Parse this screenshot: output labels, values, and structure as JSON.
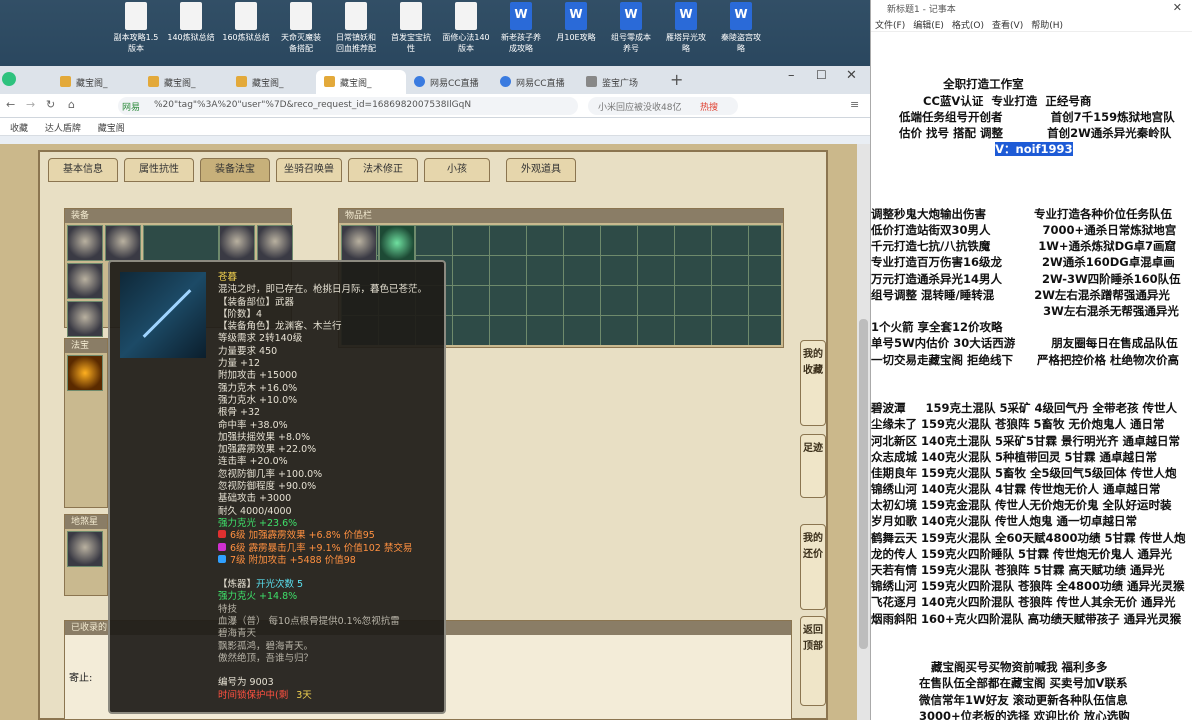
{
  "desktop_icons": [
    {
      "label": "副本攻略1.5\n版本",
      "word": false
    },
    {
      "label": "140炼狱总结",
      "word": false
    },
    {
      "label": "160炼狱总结",
      "word": false
    },
    {
      "label": "天命灭魔装\n备搭配",
      "word": false
    },
    {
      "label": "日常镇妖和\n回血推荐配",
      "word": false
    },
    {
      "label": "首发宝宝抗\n性",
      "word": false
    },
    {
      "label": "面修心法140\n版本",
      "word": false
    },
    {
      "label": "新老孩子养\n成攻略",
      "word": true
    },
    {
      "label": "月10E攻略",
      "word": true
    },
    {
      "label": "组号零成本\n养号",
      "word": true
    },
    {
      "label": "雁塔异光攻\n略",
      "word": true
    },
    {
      "label": "秦陵盗宫攻\n略",
      "word": true
    }
  ],
  "browser": {
    "tabs": [
      "藏宝阁_",
      "藏宝阁_",
      "藏宝阁_",
      "藏宝阁_",
      "网易CC直播",
      "网易CC直播",
      "鉴宝广场"
    ],
    "url": "%20\"tag\"%3A%20\"user\"%7D&reco_request_id=1686982007538IlGqN",
    "site_label": "网易",
    "search_text": "小米回应被没收48亿",
    "hot_label": "热搜",
    "bookmarks": [
      "收藏",
      "达人盾牌",
      "藏宝阁"
    ]
  },
  "game": {
    "tabs": [
      "基本信息",
      "属性抗性",
      "装备法宝",
      "坐骑召唤兽",
      "法术修正",
      "小孩",
      "外观道具"
    ],
    "equip_panel": "装备",
    "inventory_panel": "物品栏",
    "fabao_panel": "法宝",
    "pet_panel": "地煞星",
    "collect_panel": "已收录的",
    "collect_label": "寄止:",
    "side_buttons": [
      "我的收藏",
      "足迹",
      "我的还价",
      "返回顶部"
    ]
  },
  "tooltip": {
    "name": "苍暮",
    "desc": "混沌之时，即已存在。枪挑日月际，暮色已苍茫。",
    "lines": [
      "【装备部位】武器",
      "【阶数】4",
      "【装备角色】龙渊客、木兰行",
      "等级需求 2转140级",
      "力量要求 450",
      "力量 +12",
      "附加攻击 +15000",
      "强力克木 +16.0%",
      "强力克水 +10.0%",
      "根骨 +32",
      "命中率 +38.0%",
      "加强扶摇效果 +8.0%",
      "加强霹雳效果 +22.0%",
      "连击率 +20.0%",
      "忽视防御几率 +100.0%",
      "忽视防御程度 +90.0%",
      "基础攻击 +3000",
      "耐久 4000/4000"
    ],
    "highlight": "强力克光 +23.6%",
    "gems": [
      "6级 加强霹雳效果 +6.8% 价值95",
      "6级 霹雳暴击几率 +9.1% 价值102 禁交易",
      "7级 附加攻击 +5488 价值98"
    ],
    "refine_label": "【炼器】",
    "refine_value": "开光次数 5",
    "refine_stat": "强力克火 +14.8%",
    "skill_title": "特技",
    "skill_desc": "血瀑（普）  每10点根骨提供0.1%忽视抗雷",
    "skill_name": "碧海青天",
    "poem1": "飘影孤鸿，碧海青天。",
    "poem2": "傲然绝顶，吾谁与归？",
    "serial": "编号为 9003",
    "bound": "时间锁保护中(剩",
    "days": "3天",
    "gem_colors": [
      "#e03030",
      "#d030d0",
      "#30a0ff"
    ]
  },
  "notepad": {
    "title": "新标题1 - 记事本",
    "menu": [
      "文件(F)",
      "编辑(E)",
      "格式(O)",
      "查看(V)",
      "帮助(H)"
    ],
    "lines": [
      "",
      "",
      "                  全职打造工作室",
      "             CC蓝V认证  专业打造  正经号商",
      "       低端任务组号开创者            首创7千159炼狱地宫队",
      "       估价 找号 搭配 调整           首创2W通杀异光秦岭队",
      "",
      "",
      "",
      "调整秒鬼大炮输出伤害            专业打造各种价位任务队伍",
      "低价打造站街双30男人             7000+通杀日常炼狱地宫",
      "千元打造七抗/八抗铁魔            1W+通杀炼狱DG卓7画窟",
      "专业打造百万伤害16级龙          2W通杀160DG卓混卓画",
      "万元打造通杀异光14男人          2W-3W四阶睡杀160队伍",
      "组号调整 混转睡/睡转混          2W左右混杀蹭帮强通异光",
      "                                           3W左右混杀无帮强通异光",
      "1个火箭 享全套12价攻略",
      "单号5W内估价 30大话西游         朋友圈每日在售成品队伍",
      "一切交易走藏宝阁 拒绝线下      严格把控价格 杜绝物次价高",
      "",
      "",
      "碧波潭     159克土混队 5采矿 4级回气丹 全带老孩 传世人",
      "尘缘未了 159克火混队 苍狼阵 5畜牧 无价炮鬼人 通日常",
      "河北新区 140克土混队 5采矿5甘霖 景行明光齐 通卓越日常",
      "众志成城 140克火混队 5种植带回灵 5甘霖 通卓越日常",
      "佳期良年 159克火混队 5畜牧 全5级回气5级回体 传世人炮",
      "锦绣山河 140克火混队 4甘霖 传世炮无价人 通卓越日常",
      "太初幻境 159克金混队 传世人无价炮无价鬼 全队好运时装",
      "岁月如歌 140克火混队 传世人炮鬼 通一切卓越日常",
      "鹤舞云天 159克火混队 全60天赋4800功绩 5甘霖 传世人炮",
      "龙的传人 159克火四阶睡队 5甘霖 传世炮无价鬼人 通异光",
      "天若有情 159克火混队 苍狼阵 5甘霖 高天赋功绩 通异光",
      "锦绣山河 159克火四阶混队 苍狼阵 全4800功绩 通异光灵猴",
      "飞花逐月 140克火四阶混队 苍狼阵 传世人其余无价 通异光",
      "烟雨斜阳 160+克火四阶混队 高功绩天赋带孩子 通异光灵猴",
      "",
      "",
      "               藏宝阁买号买物资前喊我 福利多多",
      "            在售队伍全部都在藏宝阁 买卖号加V联系",
      "            微信常年1W好友 滚动更新各种队伍信息",
      "            3000+位老板的选择 欢迎比价 放心选购"
    ],
    "wechat_prefix": "                               ",
    "wechat": "V：noif1993"
  }
}
